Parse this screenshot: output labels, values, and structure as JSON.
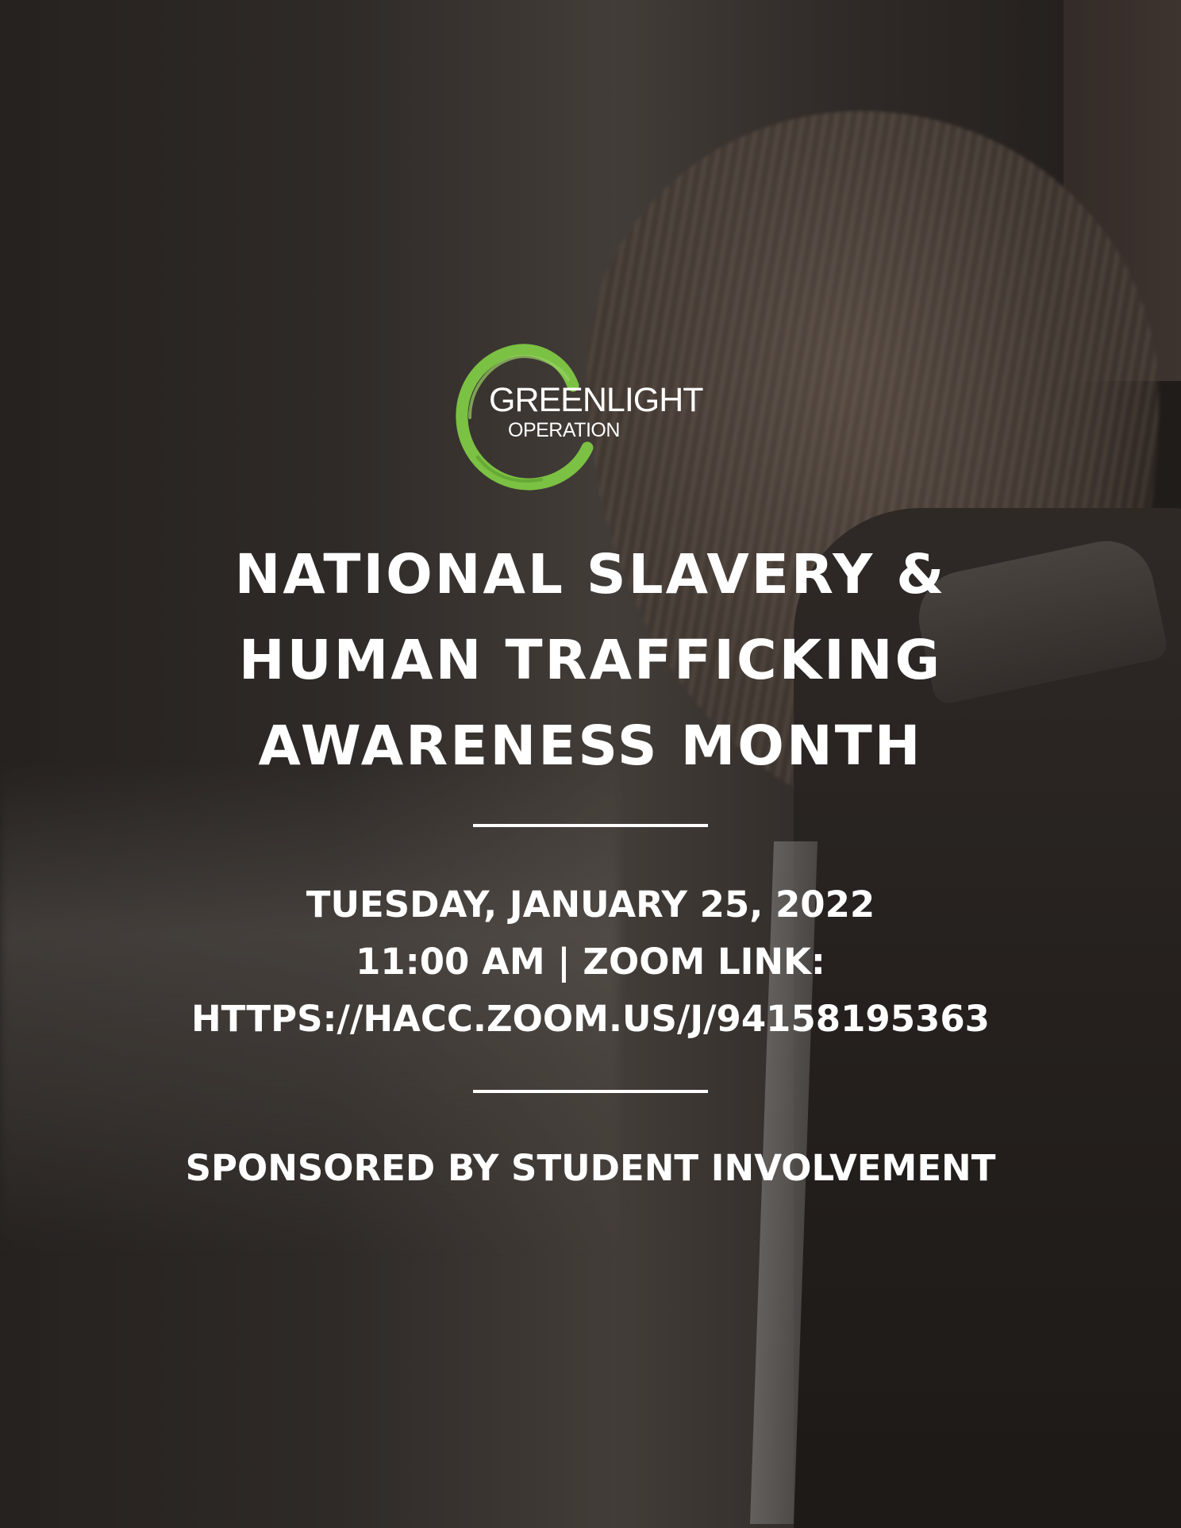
{
  "logo": {
    "line1": "GREENLIGHT",
    "line2": "OPERATION",
    "ring_color": "#7bc143"
  },
  "title": {
    "line1": "NATIONAL SLAVERY &",
    "line2": "HUMAN TRAFFICKING",
    "line3": "AWARENESS MONTH"
  },
  "event": {
    "date": "TUESDAY, JANUARY 25, 2022",
    "time_line": "11:00 AM | ZOOM LINK:",
    "link": "HTTPS://HACC.ZOOM.US/J/94158195363"
  },
  "sponsor": "SPONSORED BY STUDENT INVOLVEMENT",
  "colors": {
    "text": "#ffffff",
    "accent": "#7bc143"
  }
}
